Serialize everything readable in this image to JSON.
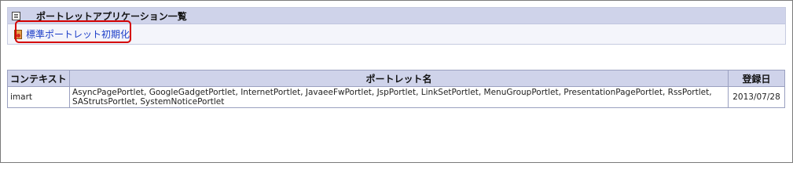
{
  "panel": {
    "title": "ポートレットアプリケーション一覧",
    "title_icon": "document-icon",
    "init_link_label": "標準ポートレット初期化",
    "init_link_icon": "reset-icon"
  },
  "table": {
    "headers": {
      "context": "コンテキスト",
      "portlets": "ポートレット名",
      "date": "登録日"
    },
    "rows": [
      {
        "context": "imart",
        "portlets": "AsyncPagePortlet, GoogleGadgetPortlet, InternetPortlet, JavaeeFwPortlet, JspPortlet, LinkSetPortlet, MenuGroupPortlet, PresentationPagePortlet, RssPortlet, SAStrutsPortlet, SystemNoticePortlet",
        "date": "2013/07/28"
      }
    ]
  },
  "colors": {
    "header_bg": "#cfd3ea",
    "link": "#1a3cc8",
    "highlight": "#d40000"
  }
}
